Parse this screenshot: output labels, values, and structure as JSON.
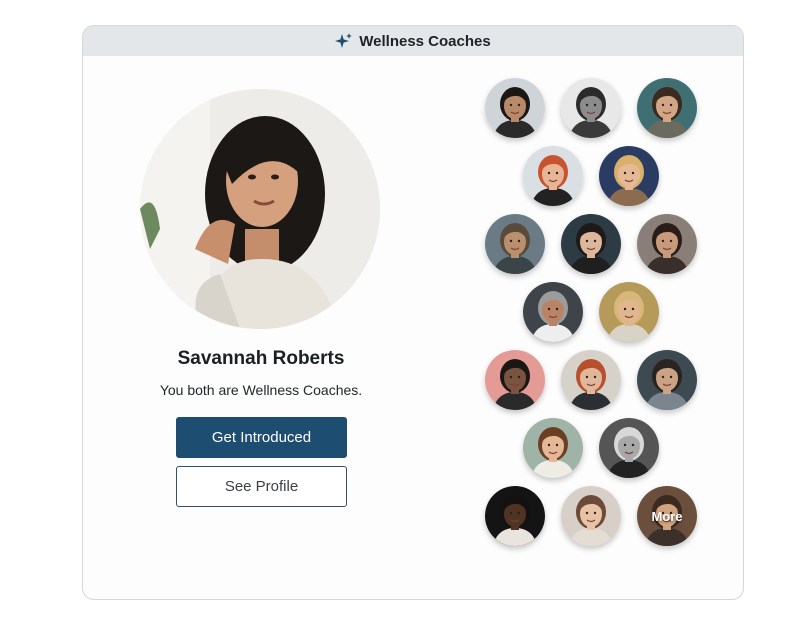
{
  "header": {
    "title": "Wellness Coaches",
    "icon": "sparkle-icon",
    "accent": "#1e4d72"
  },
  "featured": {
    "name": "Savannah Roberts",
    "subtitle": "You both are Wellness Coaches.",
    "primary_label": "Get Introduced",
    "secondary_label": "See Profile"
  },
  "people": [
    {
      "id": "coach-1",
      "skin": "#b98a6a",
      "hair": "#1b1714",
      "bg": "#cfd4d8",
      "shirt": "#2a2a2a"
    },
    {
      "id": "coach-2",
      "skin": "#8c8c8c",
      "hair": "#2b2b2b",
      "bg": "#e8e8e8",
      "shirt": "#3a3a3a"
    },
    {
      "id": "coach-3",
      "skin": "#d2a685",
      "hair": "#3a2a1f",
      "bg": "#3f6e73",
      "shirt": "#6a6a5e"
    },
    {
      "id": "coach-4",
      "skin": "#e7b596",
      "hair": "#c7542f",
      "bg": "#d9dfe3",
      "shirt": "#222222"
    },
    {
      "id": "coach-5",
      "skin": "#e6b996",
      "hair": "#d9b06a",
      "bg": "#2b3c63",
      "shirt": "#8b6c4e"
    },
    {
      "id": "coach-6",
      "skin": "#b9906e",
      "hair": "#5a4a3a",
      "bg": "#6b7b86",
      "shirt": "#3a4548"
    },
    {
      "id": "coach-7",
      "skin": "#dcb79b",
      "hair": "#1d1a19",
      "bg": "#2c3b44",
      "shirt": "#1f1f1f"
    },
    {
      "id": "coach-8",
      "skin": "#c89a7c",
      "hair": "#2a1c16",
      "bg": "#8a7f78",
      "shirt": "#3a2e2a"
    },
    {
      "id": "coach-9",
      "skin": "#b98466",
      "hair": "#9c9c9c",
      "bg": "#3e4449",
      "shirt": "#eeeeee"
    },
    {
      "id": "coach-10",
      "skin": "#e0b68f",
      "hair": "#d8b779",
      "bg": "#b69a5a",
      "shirt": "#d9d2c6"
    },
    {
      "id": "coach-11",
      "skin": "#7a5440",
      "hair": "#1b1714",
      "bg": "#e49a95",
      "shirt": "#2a2a2a"
    },
    {
      "id": "coach-12",
      "skin": "#e0b79a",
      "hair": "#b8502e",
      "bg": "#d7d2c9",
      "shirt": "#2b2e33"
    },
    {
      "id": "coach-13",
      "skin": "#c9a383",
      "hair": "#2a2420",
      "bg": "#3e4a52",
      "shirt": "#7a8590"
    },
    {
      "id": "coach-14",
      "skin": "#e4b897",
      "hair": "#6a3f23",
      "bg": "#9fb3a7",
      "shirt": "#efece6"
    },
    {
      "id": "coach-15",
      "skin": "#a8a8a8",
      "hair": "#d8d8d8",
      "bg": "#555555",
      "shirt": "#222222"
    },
    {
      "id": "coach-16",
      "skin": "#4f3424",
      "hair": "#151110",
      "bg": "#141414",
      "shirt": "#e9e4dd"
    },
    {
      "id": "coach-17",
      "skin": "#e8c2a6",
      "hair": "#6b4a37",
      "bg": "#d7cfc8",
      "shirt": "#e4ddd4"
    },
    {
      "id": "coach-18",
      "skin": "#d0a27e",
      "hair": "#3a2a20",
      "bg": "#6b4e3c",
      "shirt": "#3b302a"
    }
  ],
  "more_label": "More"
}
